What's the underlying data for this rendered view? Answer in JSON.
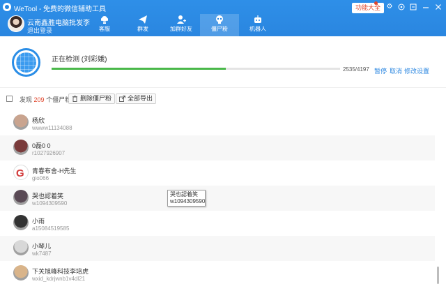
{
  "window": {
    "title": "WeTool - 免费的微信辅助工具",
    "feature_button": "功能大全"
  },
  "user": {
    "name": "云南鑫胜电脑批发李",
    "logout": "退出登录"
  },
  "nav": {
    "tabs": [
      {
        "label": "客服",
        "icon": "customer-service-icon"
      },
      {
        "label": "群发",
        "icon": "send-icon"
      },
      {
        "label": "加群好友",
        "icon": "add-friend-icon"
      },
      {
        "label": "僵尸粉",
        "icon": "zombie-icon",
        "active": true
      },
      {
        "label": "机器人",
        "icon": "robot-icon"
      }
    ]
  },
  "progress": {
    "status": "正在检测 (刘彩娥)",
    "current": 2535,
    "total": 4197,
    "count_text": "2535/4197",
    "pause": "暂停",
    "cancel": "取消",
    "settings": "修改设置"
  },
  "toolbar": {
    "found_prefix": "发现",
    "found_count": "209",
    "found_suffix": "个僵尸粉",
    "delete_label": "删除僵尸粉",
    "export_label": "全部导出"
  },
  "list": [
    {
      "name": "杨欣",
      "id": "wwww11134088",
      "avatar_color": "#c9a48f"
    },
    {
      "name": "0磊0 0",
      "id": "r1027926907",
      "avatar_color": "#7a3b3b"
    },
    {
      "name": "青春布舍-H先生",
      "id": "gio066",
      "avatar_color": "#ffffff"
    },
    {
      "name": "哭也認着笑",
      "id": "w1094309590",
      "avatar_color": "#5a4a55"
    },
    {
      "name": "小雨",
      "id": "a15084519585",
      "avatar_color": "#333333"
    },
    {
      "name": "小琴儿",
      "id": "wk7487",
      "avatar_color": "#d8d8d8"
    },
    {
      "name": "下关旭峰科技李培虎",
      "id": "wxid_kdrjwnb1v4dl21",
      "avatar_color": "#d9b48a"
    }
  ],
  "tooltip": {
    "name": "哭也認着笑",
    "id": "w1094309590"
  },
  "colors": {
    "header": "#2a86e0",
    "accent": "#2a86e0",
    "progress": "#4ab84a",
    "highlight": "#e0452b"
  }
}
